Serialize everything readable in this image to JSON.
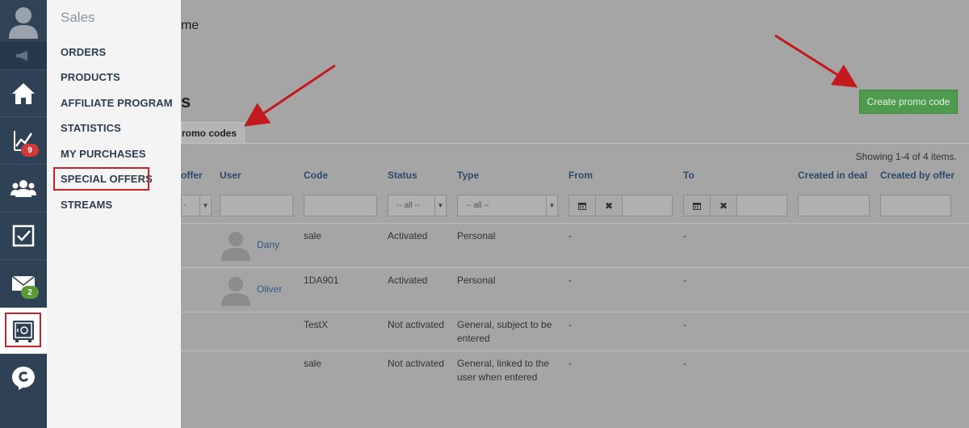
{
  "rail": {
    "items": [
      {
        "name": "home",
        "icon": "home-icon"
      },
      {
        "name": "statistics",
        "icon": "chart-icon",
        "badge": "9"
      },
      {
        "name": "users",
        "icon": "users-icon"
      },
      {
        "name": "tasks",
        "icon": "checkbox-icon"
      },
      {
        "name": "mail",
        "icon": "mail-icon",
        "badge": "2"
      },
      {
        "name": "sales",
        "icon": "safe-icon"
      },
      {
        "name": "chat",
        "icon": "chat-icon"
      }
    ]
  },
  "flyout": {
    "title": "Sales",
    "items": [
      "ORDERS",
      "PRODUCTS",
      "AFFILIATE PROGRAM",
      "STATISTICS",
      "MY PURCHASES",
      "SPECIAL OFFERS",
      "STREAMS"
    ]
  },
  "main": {
    "top_text": "me",
    "title": "s",
    "create_button": "Create promo code",
    "tab_label": "romo codes",
    "summary": "Showing 1-4 of 4 items."
  },
  "table": {
    "headers": [
      "offer",
      "User",
      "Code",
      "Status",
      "Type",
      "From",
      "To",
      "Created in deal",
      "Created by offer"
    ],
    "filters": {
      "offer_select": "-",
      "status_select": "-- all --",
      "type_select": "-- all --"
    },
    "rows": [
      {
        "user": "Dany",
        "code": "sale",
        "status": "Activated",
        "type": "Personal",
        "from": "-",
        "to": "-"
      },
      {
        "user": "Oliver",
        "code": "1DA901",
        "status": "Activated",
        "type": "Personal",
        "from": "-",
        "to": "-"
      },
      {
        "user": "",
        "code": "TestX",
        "status": "Not activated",
        "type": "General, subject to be entered",
        "from": "-",
        "to": "-"
      },
      {
        "user": "",
        "code": "sale",
        "status": "Not activated",
        "type": "General, linked to the user when entered",
        "from": "-",
        "to": "-"
      }
    ]
  },
  "colors": {
    "rail": "#2f4255",
    "accent_green": "#4e9a4e",
    "highlight_red": "#c0262b",
    "link": "#2a4a6b"
  }
}
